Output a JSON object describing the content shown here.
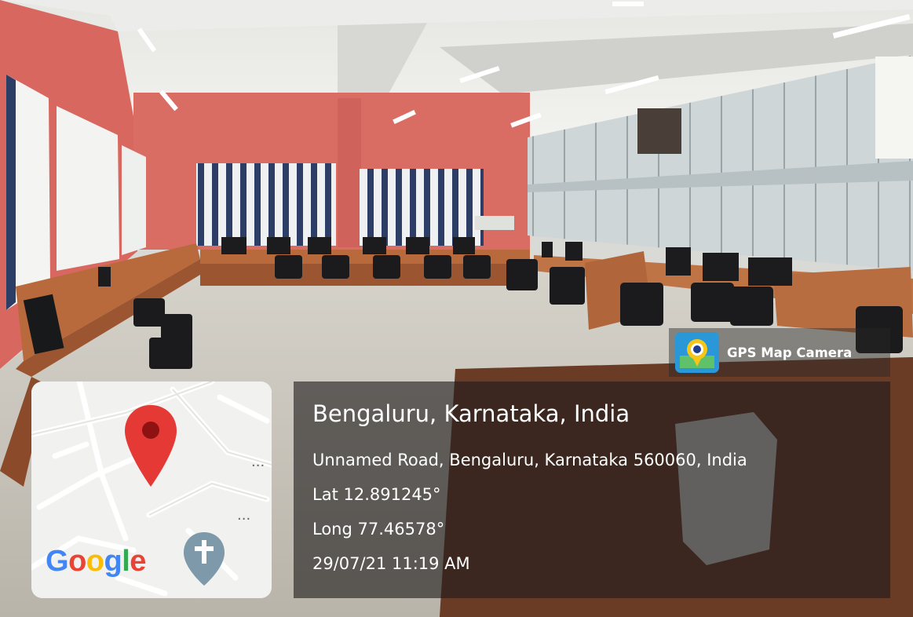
{
  "app": {
    "name": "GPS Map Camera",
    "icon": "gps-map-camera-icon"
  },
  "map": {
    "brand": [
      "G",
      "o",
      "o",
      "g",
      "l",
      "e"
    ],
    "brand_colors": [
      "#4285F4",
      "#EA4335",
      "#FBBC05",
      "#4285F4",
      "#34A853",
      "#EA4335"
    ],
    "pin_icon": "location-pin-icon",
    "landmark_icon": "church-cross-icon",
    "more_icon": "ellipsis-icon",
    "more_label": "...",
    "pin_color": "#E53935"
  },
  "location": {
    "city": "Bengaluru, Karnataka, India",
    "address": "Unnamed Road, Bengaluru, Karnataka 560060, India",
    "latitude": "Lat 12.891245°",
    "longitude": "Long 77.46578°",
    "datetime": "29/07/21 11:19 AM"
  },
  "scene": {
    "wall_color": "#d8685f",
    "floor_color": "#c9c5bd",
    "desk_color": "#b86a3c"
  }
}
